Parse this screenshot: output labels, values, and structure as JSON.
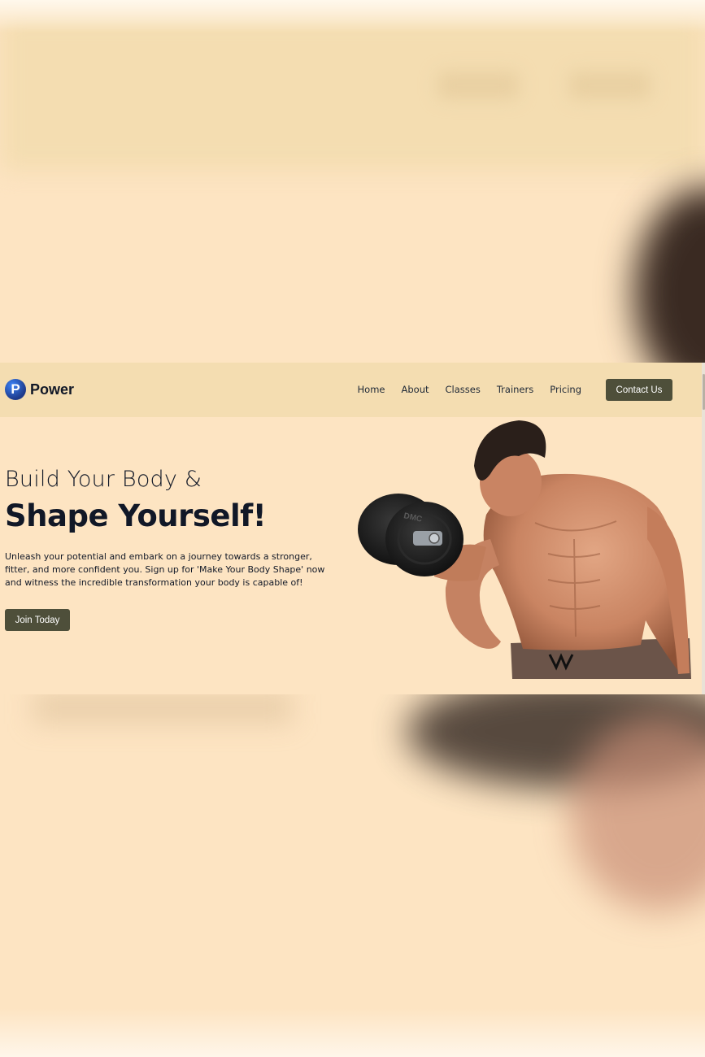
{
  "brand": {
    "name": "Power",
    "logo_letter": "P"
  },
  "nav": {
    "items": [
      {
        "label": "Home"
      },
      {
        "label": "About"
      },
      {
        "label": "Classes"
      },
      {
        "label": "Trainers"
      },
      {
        "label": "Pricing"
      }
    ],
    "contact_label": "Contact Us"
  },
  "hero": {
    "line1": "Build Your Body &",
    "line2": "Shape Yourself!",
    "description": "Unleash your potential and embark on a journey towards a stronger, fitter, and more confident you. Sign up for 'Make Your Body Shape' now and witness the incredible transformation your body is capable of!",
    "cta_label": "Join Today",
    "image_icon": "bodybuilder-with-dumbbell-image",
    "dumbbell_text": "DMC"
  },
  "colors": {
    "page_bg": "#fde4c2",
    "navbar_bg": "#f4ddb1",
    "button_bg": "#4e4f3a",
    "text": "#111827"
  }
}
